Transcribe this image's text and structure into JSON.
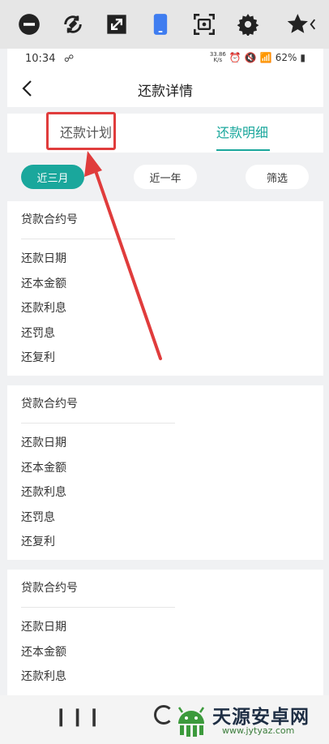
{
  "toolbar": {
    "icons": [
      "minus-circle-icon",
      "rotate-icon",
      "expand-icon",
      "phone-icon",
      "screenshot-icon",
      "gear-icon",
      "star-icon"
    ]
  },
  "status": {
    "time": "10:34",
    "speed_top": "33.86",
    "speed_bottom": "K/s",
    "battery": "62%"
  },
  "nav": {
    "title": "还款详情"
  },
  "tabs": {
    "plan": "还款计划",
    "detail": "还款明细"
  },
  "filters": {
    "recent3m": "近三月",
    "recent1y": "近一年",
    "filter": "筛选"
  },
  "cards": [
    {
      "contract": "贷款合约号",
      "rows": [
        "还款日期",
        "还本金额",
        "还款利息",
        "还罚息",
        "还复利"
      ]
    },
    {
      "contract": "贷款合约号",
      "rows": [
        "还款日期",
        "还本金额",
        "还款利息",
        "还罚息",
        "还复利"
      ]
    },
    {
      "contract": "贷款合约号",
      "rows": [
        "还款日期",
        "还本金额",
        "还款利息"
      ]
    }
  ],
  "watermark": {
    "title": "天源安卓网",
    "url": "www.jytyaz.com"
  },
  "colors": {
    "accent": "#1aa79c",
    "highlight": "#e03c3c"
  }
}
